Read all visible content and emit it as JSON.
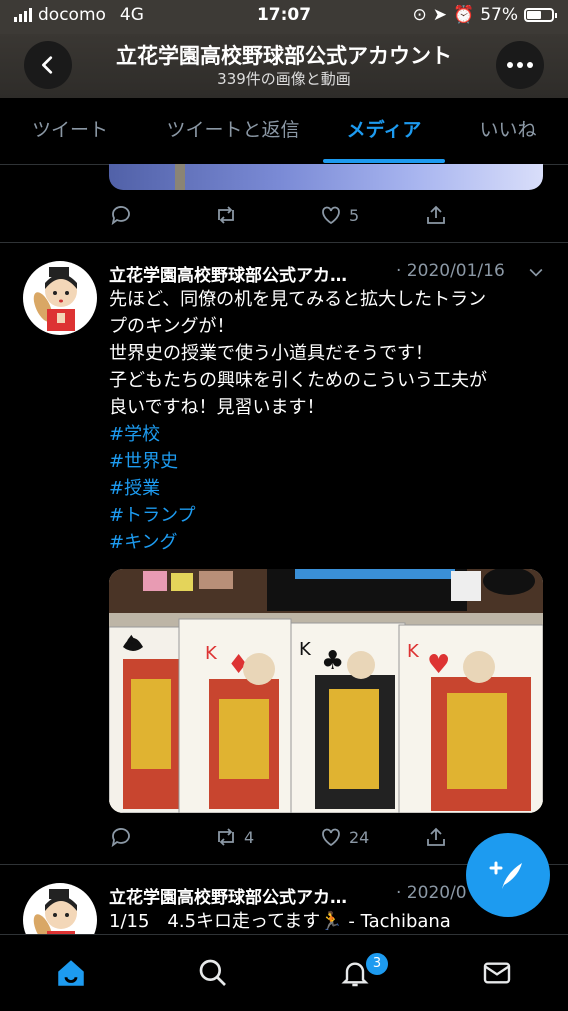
{
  "status_bar": {
    "carrier": "docomo",
    "network": "4G",
    "time": "17:07",
    "battery": "57%"
  },
  "header": {
    "title": "立花学園高校野球部公式アカウント",
    "subtitle": "339件の画像と動画"
  },
  "tabs": [
    {
      "label": "ツイート"
    },
    {
      "label": "ツイートと返信"
    },
    {
      "label": "メディア"
    },
    {
      "label": "いいね"
    }
  ],
  "prev_tweet": {
    "likes": "5"
  },
  "tweet1": {
    "name": "立花学園高校野球部公式アカ…",
    "date": "· 2020/01/16",
    "lines": [
      "先ほど、同僚の机を見てみると拡大したトラン",
      "プのキングが！",
      "世界史の授業で使う小道具だそうです！",
      "子どもたちの興味を引くためのこういう工夫が",
      "良いですね！見習います！"
    ],
    "hashtags": [
      "#学校",
      "#世界史",
      "#授業",
      "#トランプ",
      "#キング"
    ],
    "retweets": "4",
    "likes": "24"
  },
  "tweet2": {
    "name": "立花学園高校野球部公式アカ…",
    "date": "· 2020/0",
    "text": "1/15　4.5キロ走ってます🏃 - Tachibana"
  },
  "bottom_nav": {
    "notifications_badge": "3"
  },
  "colors": {
    "accent": "#1d9bf0",
    "muted": "#8b98a5",
    "background": "#000000"
  }
}
